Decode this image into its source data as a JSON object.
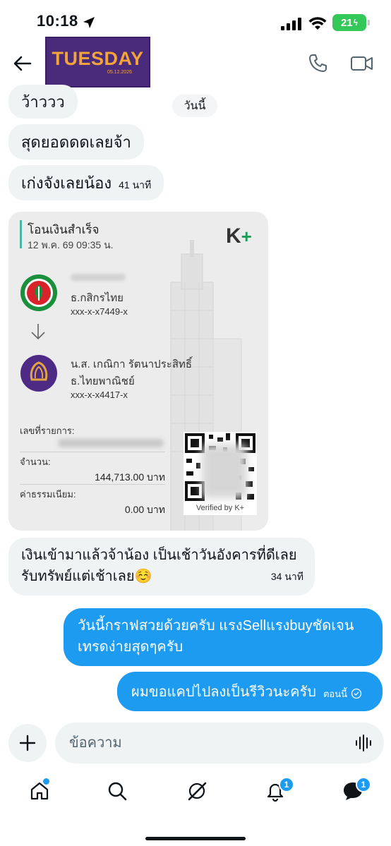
{
  "status_bar": {
    "time": "10:18",
    "battery": "21"
  },
  "header": {
    "avatar_title": "TUESDAY",
    "avatar_date": "05.12.2026"
  },
  "day_separator": "วันนี้",
  "messages_in": [
    {
      "text": "ว้าววว",
      "time": ""
    },
    {
      "text": "สุดยอดดดเลยจ้า",
      "time": ""
    },
    {
      "text": "เก่งจังเลยน้อง",
      "time": "41 นาที"
    }
  ],
  "slip": {
    "title": "โอนเงินสำเร็จ",
    "date": "12 พ.ค. 69 09:35 น.",
    "brand": "K",
    "brand_plus": "+",
    "sender": {
      "bank": "ธ.กสิกรไทย",
      "account": "xxx-x-x7449-x"
    },
    "receiver": {
      "name": "น.ส. เกณิกา รัตนาประสิทธิ์",
      "bank": "ธ.ไทยพาณิชย์",
      "account": "xxx-x-x4417-x"
    },
    "ref_label": "เลขที่รายการ:",
    "amount_label": "จำนวน:",
    "amount_value": "144,713.00 บาท",
    "fee_label": "ค่าธรรมเนียม:",
    "fee_value": "0.00 บาท",
    "qr_caption": "Verified by K+",
    "colors": {
      "kbank_green": "#1a8f3c",
      "kbank_red": "#d8232a",
      "scb_purple": "#4e2a84",
      "scb_gold": "#e2a640"
    }
  },
  "message_after_slip": {
    "line1": "เงินเข้ามาแล้วจ้าน้อง เป็นเช้าวันอังคารที่ดีเลย",
    "line2": "รับทรัพย์แต่เช้าเลย",
    "emoji": "☺️",
    "time": "34 นาที"
  },
  "messages_out": [
    {
      "line1": "วันนี้กราฟสวยด้วยครับ แรงSellแรงbuyชัดเจน",
      "line2": "เทรดง่ายสุดๆครับ"
    },
    {
      "line1": "ผมขอแคปไปลงเป็นรีวิวนะครับ",
      "time": "ตอนนี้"
    }
  ],
  "composer": {
    "placeholder": "ข้อความ"
  },
  "tabs": {
    "notifications_badge": "1",
    "messages_badge": "1"
  },
  "accent_color": "#1d9bf0"
}
